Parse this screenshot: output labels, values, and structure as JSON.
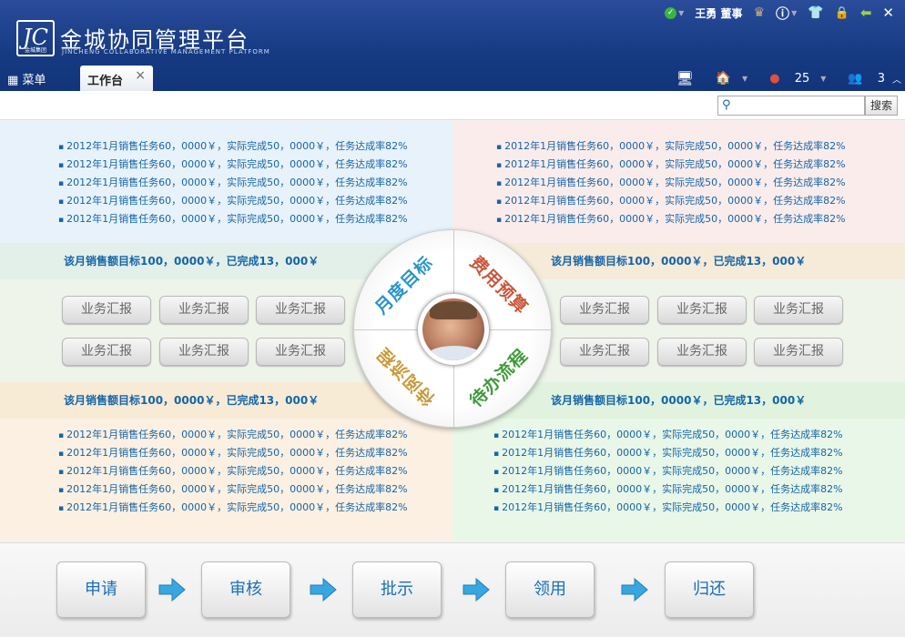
{
  "header": {
    "logo_text": "JC",
    "logo_sub": "金城集团",
    "title": "金城协同管理平台",
    "subtitle": "JINCHENG COLLABORATIVE MANAGEMENT PLATFORM",
    "user": "王勇 董事"
  },
  "tabbar": {
    "menu_label": "菜单",
    "active_tab": "工作台",
    "close_glyph": "×",
    "messages_count": "25",
    "users_count": "3"
  },
  "search": {
    "button": "搜索",
    "placeholder": ""
  },
  "quadrants": {
    "top_left": {
      "items": [
        "2012年1月销售任务60，0000￥，实际完成50，0000￥，任务达成率82%",
        "2012年1月销售任务60，0000￥，实际完成50，0000￥，任务达成率82%",
        "2012年1月销售任务60，0000￥，实际完成50，0000￥，任务达成率82%",
        "2012年1月销售任务60，0000￥，实际完成50，0000￥，任务达成率82%",
        "2012年1月销售任务60，0000￥，实际完成50，0000￥，任务达成率82%"
      ],
      "band": "该月销售额目标100，0000￥，已完成13，000￥"
    },
    "top_right": {
      "items": [
        "2012年1月销售任务60，0000￥，实际完成50，0000￥，任务达成率82%",
        "2012年1月销售任务60，0000￥，实际完成50，0000￥，任务达成率82%",
        "2012年1月销售任务60，0000￥，实际完成50，0000￥，任务达成率82%",
        "2012年1月销售任务60，0000￥，实际完成50，0000￥，任务达成率82%",
        "2012年1月销售任务60，0000￥，实际完成50，0000￥，任务达成率82%"
      ],
      "band": "该月销售额目标100，0000￥，已完成13，000￥"
    },
    "bottom_left": {
      "band": "该月销售额目标100，0000￥，已完成13，000￥",
      "items": [
        "2012年1月销售任务60，0000￥，实际完成50，0000￥，任务达成率82%",
        "2012年1月销售任务60，0000￥，实际完成50，0000￥，任务达成率82%",
        "2012年1月销售任务60，0000￥，实际完成50，0000￥，任务达成率82%",
        "2012年1月销售任务60，0000￥，实际完成50，0000￥，任务达成率82%",
        "2012年1月销售任务60，0000￥，实际完成50，0000￥，任务达成率82%"
      ]
    },
    "bottom_right": {
      "band": "该月销售额目标100，0000￥，已完成13，000￥",
      "items": [
        "2012年1月销售任务60，0000￥，实际完成50，0000￥，任务达成率82%",
        "2012年1月销售任务60，0000￥，实际完成50，0000￥，任务达成率82%",
        "2012年1月销售任务60，0000￥，实际完成50，0000￥，任务达成率82%",
        "2012年1月销售任务60，0000￥，实际完成50，0000￥，任务达成率82%",
        "2012年1月销售任务60，0000￥，实际完成50，0000￥，任务达成率82%"
      ]
    }
  },
  "report_buttons": {
    "left": [
      "业务汇报",
      "业务汇报",
      "业务汇报",
      "业务汇报",
      "业务汇报",
      "业务汇报"
    ],
    "right": [
      "业务汇报",
      "业务汇报",
      "业务汇报",
      "业务汇报",
      "业务汇报",
      "业务汇报"
    ]
  },
  "wheel": {
    "top_left": "月度目标",
    "top_right": "费用预算",
    "bottom_left": "待阅流程",
    "bottom_right": "待办流程"
  },
  "flow": {
    "steps": [
      "申请",
      "审核",
      "批示",
      "领用",
      "归还"
    ]
  },
  "colors": {
    "header_blue": "#163a82",
    "link_blue": "#1565a8",
    "q_top_left": "#e8f2fa",
    "q_top_right": "#fbecec",
    "q_bottom_left": "#fbf0e2",
    "q_bottom_right": "#e9f7e8",
    "wheel_top_left": "#2b95c8",
    "wheel_top_right": "#c9573c",
    "wheel_bottom_left": "#c79a3a",
    "wheel_bottom_right": "#3f9a3a",
    "flow_arrow": "#3aa6e0"
  }
}
